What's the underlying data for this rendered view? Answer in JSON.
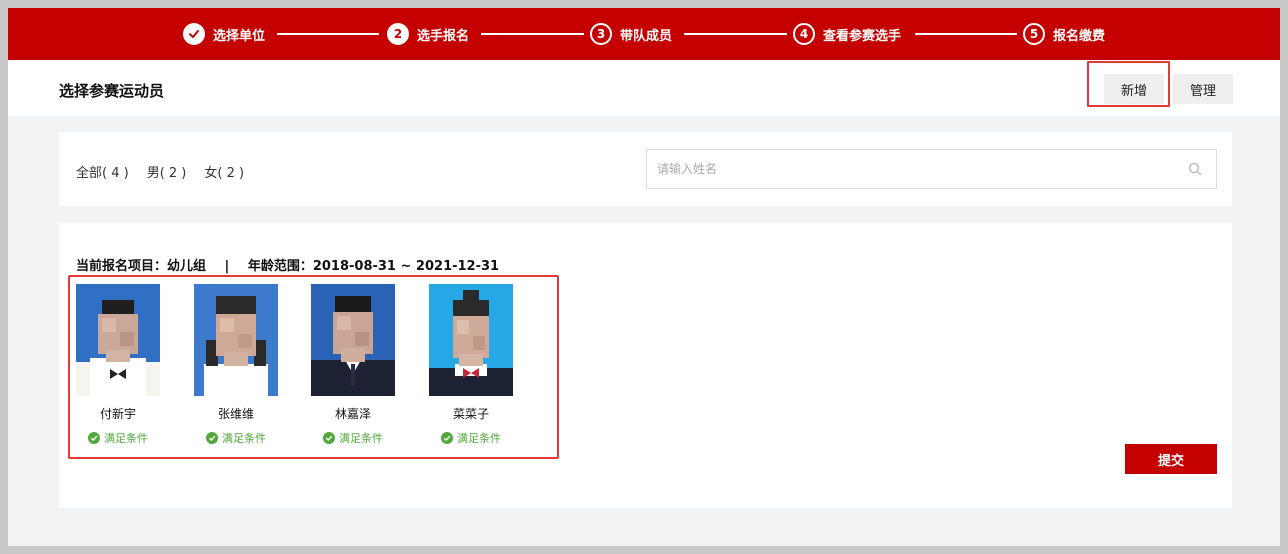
{
  "stepper": {
    "steps": [
      {
        "number": "",
        "label": "选择单位",
        "state": "done"
      },
      {
        "number": "2",
        "label": "选手报名",
        "state": "active"
      },
      {
        "number": "3",
        "label": "带队成员",
        "state": "todo"
      },
      {
        "number": "4",
        "label": "查看参赛选手",
        "state": "todo"
      },
      {
        "number": "5",
        "label": "报名缴费",
        "state": "todo"
      }
    ]
  },
  "header": {
    "title": "选择参赛运动员",
    "add_label": "新增",
    "manage_label": "管理"
  },
  "filters": {
    "tabs": [
      "全部( 4 )",
      "男( 2 )",
      "女( 2 )"
    ],
    "search_placeholder": "请输入姓名",
    "search_value": ""
  },
  "project": {
    "label": "当前报名项目：幼儿组",
    "separator": "|",
    "age_range": "年龄范围：2018-08-31 ~ 2021-12-31"
  },
  "athletes": [
    {
      "name": "付新宇",
      "status": "满足条件",
      "gender": "male",
      "bg": "#2f6fc4"
    },
    {
      "name": "张维维",
      "status": "满足条件",
      "gender": "female",
      "bg": "#3d79cc"
    },
    {
      "name": "林嘉泽",
      "status": "满足条件",
      "gender": "male",
      "bg": "#2a62b5"
    },
    {
      "name": "菜菜子",
      "status": "满足条件",
      "gender": "female",
      "bg": "#27a8e6"
    }
  ],
  "submit_label": "提交",
  "colors": {
    "brand": "#c40000",
    "success": "#52a83c",
    "highlight": "#e53935"
  }
}
